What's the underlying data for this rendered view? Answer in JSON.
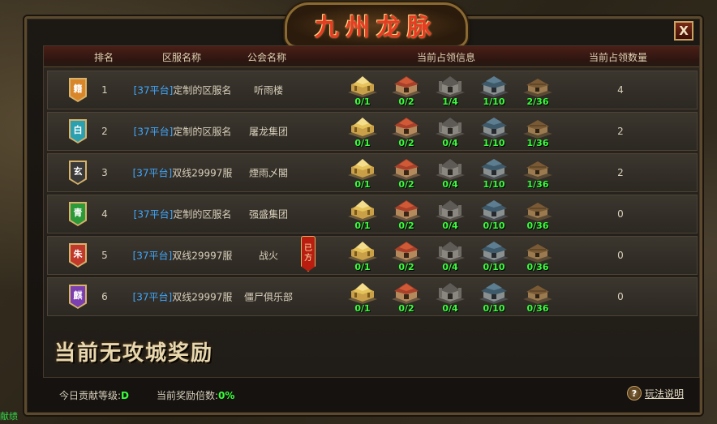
{
  "window": {
    "title": "九州龙脉",
    "close_label": "X",
    "left_edge_text": "献绩"
  },
  "table": {
    "headers": {
      "rank": "排名",
      "server": "区服名称",
      "guild": "公会名称",
      "occupation": "当前占领信息",
      "count": "当前占领数量"
    },
    "rows": [
      {
        "badge": "籍",
        "badge_color": "#d9862a",
        "rank": "1",
        "platform": "[37平台]",
        "server": "定制的区服名",
        "guild": "听雨楼",
        "buildings": [
          "0/1",
          "0/2",
          "1/4",
          "1/10",
          "2/36"
        ],
        "count": "4"
      },
      {
        "badge": "白",
        "badge_color": "#2ba0b0",
        "rank": "2",
        "platform": "[37平台]",
        "server": "定制的区服名",
        "guild": "屠龙集团",
        "buildings": [
          "0/1",
          "0/2",
          "0/4",
          "1/10",
          "1/36"
        ],
        "count": "2"
      },
      {
        "badge": "玄",
        "badge_color": "#3a3a3a",
        "rank": "3",
        "platform": "[37平台]",
        "server": "双线29997服",
        "guild": "煙雨乄閣",
        "buildings": [
          "0/1",
          "0/2",
          "0/4",
          "1/10",
          "1/36"
        ],
        "count": "2"
      },
      {
        "badge": "青",
        "badge_color": "#2d9a3a",
        "rank": "4",
        "platform": "[37平台]",
        "server": "定制的区服名",
        "guild": "强盛集团",
        "buildings": [
          "0/1",
          "0/2",
          "0/4",
          "0/10",
          "0/36"
        ],
        "count": "0"
      },
      {
        "badge": "朱",
        "badge_color": "#c0392b",
        "rank": "5",
        "platform": "[37平台]",
        "server": "双线29997服",
        "guild": "战火",
        "seal": "已方",
        "buildings": [
          "0/1",
          "0/2",
          "0/4",
          "0/10",
          "0/36"
        ],
        "count": "0"
      },
      {
        "badge": "麒",
        "badge_color": "#7b3fb0",
        "rank": "6",
        "platform": "[37平台]",
        "server": "双线29997服",
        "guild": "僵尸俱乐部",
        "buildings": [
          "0/1",
          "0/2",
          "0/4",
          "0/10",
          "0/36"
        ],
        "count": "0"
      }
    ],
    "building_icons": [
      "gold-palace-icon",
      "red-temple-icon",
      "gray-fortress-icon",
      "blue-hall-icon",
      "wooden-house-icon"
    ]
  },
  "no_reward_text": "当前无攻城奖励",
  "footer": {
    "contribution_label": "今日贡献等级:",
    "contribution_value": "D",
    "multiplier_label": "当前奖励倍数:",
    "multiplier_value": "0%",
    "help_icon": "?",
    "help_label": "玩法说明"
  },
  "colors": {
    "platform_blue": "#3fa8ff",
    "count_green": "#37ff3a",
    "title_red": "#e83b22"
  }
}
